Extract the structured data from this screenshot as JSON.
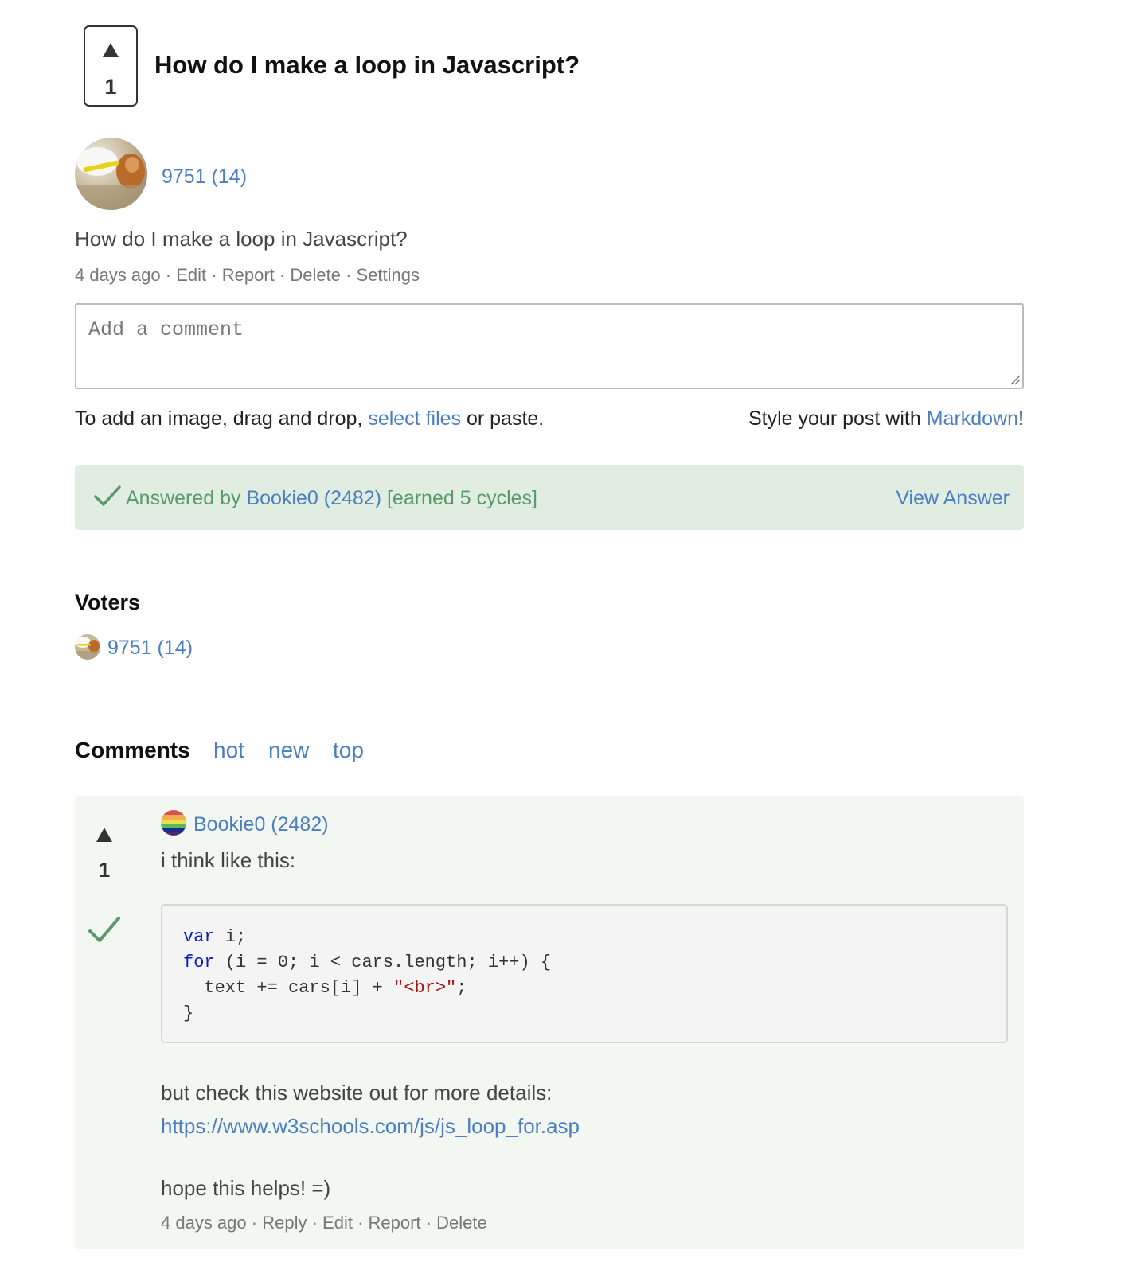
{
  "post": {
    "vote_count": "1",
    "title": "How do I make a loop in Javascript?",
    "author": "9751 (14)",
    "body": "How do I make a loop in Javascript?",
    "meta": {
      "time": "4 days ago",
      "sep": "·",
      "actions": [
        "Edit",
        "Report",
        "Delete",
        "Settings"
      ]
    }
  },
  "comment_form": {
    "placeholder": "Add a comment",
    "image_hint_before": "To add an image, drag and drop, ",
    "image_hint_link": "select files",
    "image_hint_after": " or paste.",
    "markdown_before": "Style your post with ",
    "markdown_link": "Markdown",
    "markdown_after": "!"
  },
  "answered": {
    "prefix": "Answered by ",
    "user": "Bookie0 (2482)",
    "suffix": " [earned 5 cycles]",
    "view_label": "View Answer",
    "colors": {
      "background": "#e1ede1",
      "text": "#5a9a6a"
    }
  },
  "voters": {
    "title": "Voters",
    "items": [
      {
        "user": "9751 (14)"
      }
    ]
  },
  "comments": {
    "title": "Comments",
    "sort_tabs": [
      "hot",
      "new",
      "top"
    ],
    "items": [
      {
        "vote_count": "1",
        "author": "Bookie0 (2482)",
        "intro": "i think like this:",
        "code": {
          "line1_kw": "var",
          "line1_rest": " i;",
          "line2_kw": "for",
          "line2_rest": " (i = 0; i < cars.length; i++) {",
          "line3_pre": "  text += cars[i] + ",
          "line3_str": "\"<br>\"",
          "line3_post": ";",
          "line4": "}"
        },
        "text2": "but check this website out for more details:",
        "link": "https://www.w3schools.com/js/js_loop_for.asp",
        "text3": "hope this helps! =)",
        "meta": {
          "time": "4 days ago",
          "sep": "·",
          "actions": [
            "Reply",
            "Edit",
            "Report",
            "Delete"
          ]
        }
      }
    ]
  },
  "icons": {
    "upvote": "upvote-triangle-icon",
    "answered": "checkmark-icon",
    "accepted": "checkmark-icon"
  },
  "colors": {
    "link": "#4a7fc1",
    "comment_background": "#f2f7f1",
    "accept_green": "#5a9a6a"
  }
}
